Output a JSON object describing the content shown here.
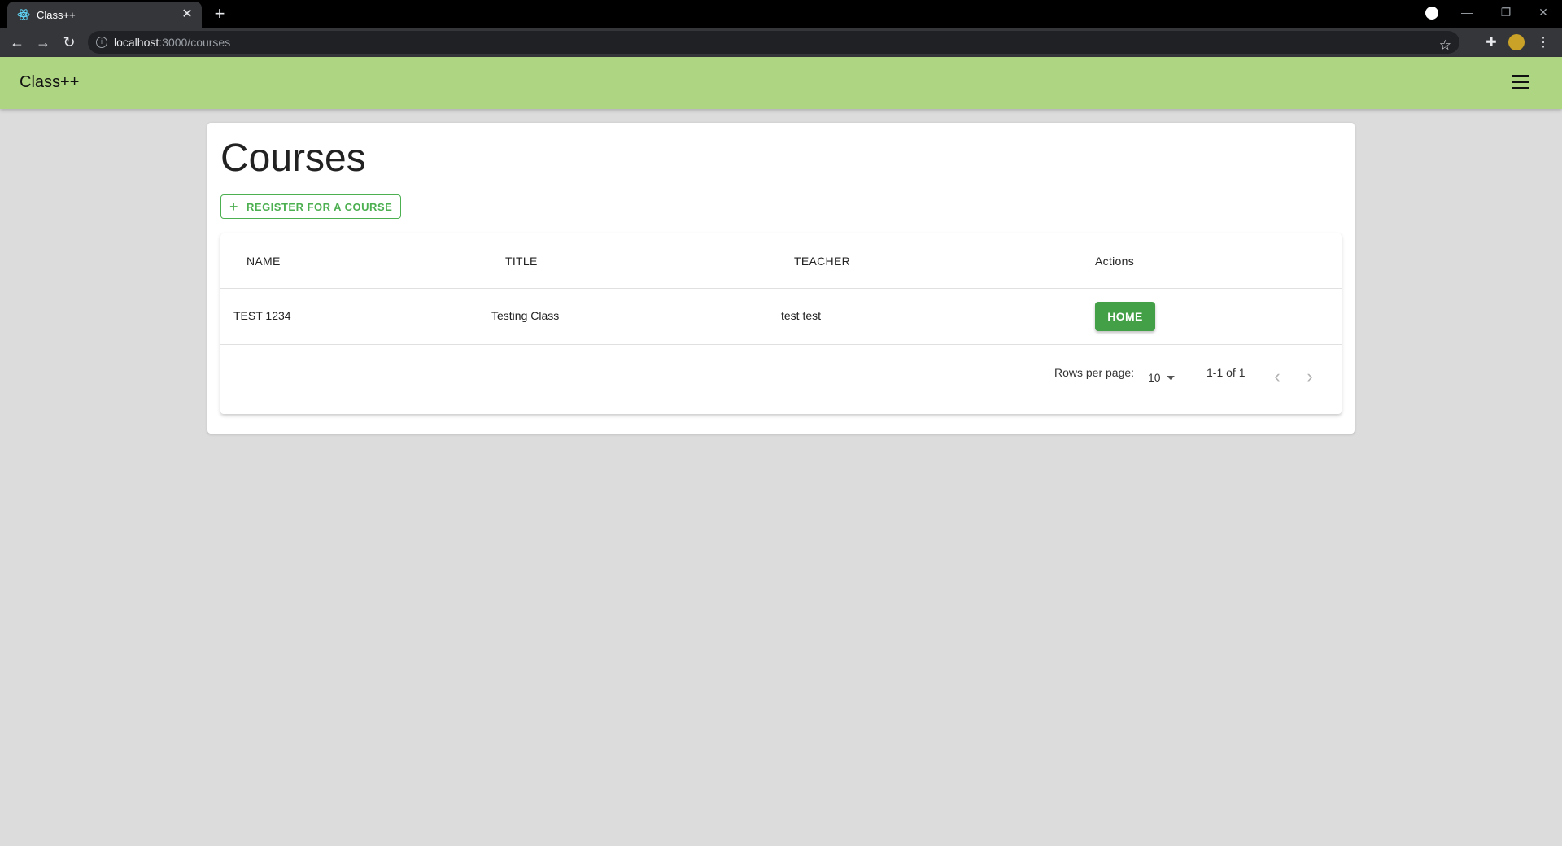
{
  "browser": {
    "tab_title": "Class++",
    "tab_close": "✕",
    "new_tab": "+",
    "url_host": "localhost",
    "url_path": ":3000/courses",
    "win_minimize": "—",
    "win_restore": "❐",
    "win_close": "✕"
  },
  "app": {
    "title": "Class++"
  },
  "page": {
    "title": "Courses",
    "register_label": "REGISTER FOR A COURSE"
  },
  "table": {
    "headers": {
      "name": "NAME",
      "title": "TITLE",
      "teacher": "TEACHER",
      "actions": "Actions"
    },
    "rows": [
      {
        "name": "TEST 1234",
        "title": "Testing Class",
        "teacher": "test test",
        "action_label": "HOME"
      }
    ]
  },
  "pagination": {
    "rows_per_page_label": "Rows per page:",
    "rows_per_page_value": "10",
    "range": "1-1 of 1"
  },
  "colors": {
    "appbar": "#aed581",
    "accent": "#4caf50",
    "home_button": "#43a047",
    "background": "#dcdcdc"
  }
}
